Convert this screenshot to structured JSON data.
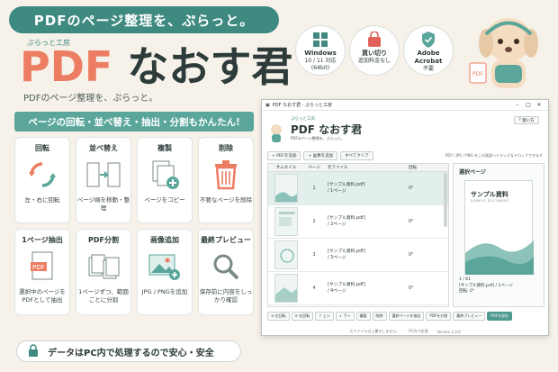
{
  "banner": {
    "text": "PDFのページ整理を、ぷらっと。"
  },
  "brand": {
    "subtitle": "ぷらっと工房",
    "title_pdf": "PDF",
    "title_rest": "なおす君",
    "tagline": "PDFのページ整理を、ぷらっと。"
  },
  "badges": [
    {
      "icon": "windows-icon",
      "line1": "Windows",
      "line2": "10 / 11 対応",
      "line3": "(64bit)"
    },
    {
      "icon": "shopping-bag-icon",
      "line1": "買い切り",
      "line2": "追加料金なし",
      "line3": ""
    },
    {
      "icon": "shield-check-icon",
      "line1": "Adobe Acrobat",
      "line2": "不要",
      "line3": ""
    }
  ],
  "feature_heading": "ページの回転・並べ替え・抽出・分割もかんたん!",
  "features": [
    {
      "name": "回転",
      "icon": "rotate-icon",
      "desc": "左・右に回転"
    },
    {
      "name": "並べ替え",
      "icon": "reorder-icon",
      "desc": "ページ順を移動・整理"
    },
    {
      "name": "複製",
      "icon": "duplicate-icon",
      "desc": "ページをコピー"
    },
    {
      "name": "削除",
      "icon": "trash-icon",
      "desc": "不要なページを削除"
    },
    {
      "name": "1ページ抽出",
      "icon": "pdf-extract-icon",
      "desc": "選択中のページをPDFとして抽出"
    },
    {
      "name": "PDF分割",
      "icon": "split-icon",
      "desc": "1ページずつ、範囲ごとに分割"
    },
    {
      "name": "画像追加",
      "icon": "image-add-icon",
      "desc": "JPG / PNGを追加"
    },
    {
      "name": "最終プレビュー",
      "icon": "magnifier-icon",
      "desc": "保存前に内容をしっかり確認"
    }
  ],
  "footer_note": "データはPC内で処理するので安心・安全",
  "colors": {
    "accent": "#3f8a80",
    "brand_pdf": "#ec7d63",
    "background": "#f6f2ea"
  },
  "window": {
    "title": "PDF なおす君 - ぷらっと工房",
    "app_sub": "ぷらっと工房",
    "app_title": "PDF なおす君",
    "app_tag": "PDFのページ整理を、ぷらっと。",
    "help_button": "使い方",
    "toolbar": {
      "add_pdf": "+ PDFを追加",
      "add_image": "+ 画像を追加",
      "clear": "すべてクリア",
      "hint": "PDF / JPG / PNG をこの画面へドラッグ＆ドロップできます"
    },
    "table": {
      "headers": [
        "サムネイル",
        "ページ",
        "元ファイル",
        "回転"
      ],
      "rows": [
        {
          "page": "1",
          "source": "[サンプル資料.pdf]",
          "source2": "/ 1ページ",
          "rotation": "0°"
        },
        {
          "page": "2",
          "source": "[サンプル資料.pdf]",
          "source2": "/ 2ページ",
          "rotation": "0°"
        },
        {
          "page": "3",
          "source": "[サンプル資料.pdf]",
          "source2": "/ 3ページ",
          "rotation": "0°"
        },
        {
          "page": "4",
          "source": "[サンプル資料.pdf]",
          "source2": "/ 4ページ",
          "rotation": "0°"
        }
      ]
    },
    "preview": {
      "label": "選択ページ",
      "doc_title": "サンプル資料",
      "doc_sub": "SAMPLE DOCUMENT",
      "info1": "1 / 61",
      "info2": "[サンプル資料.pdf] / 1ページ",
      "info3": "回転: 0°"
    },
    "bottom_buttons": [
      "⟲ 左回転",
      "⟳ 右回転",
      "↑ 上へ",
      "↓ 下へ",
      "複製",
      "削除",
      "選択ページを抽出",
      "PDFを分割",
      "最終プレビュー",
      "PDFを保存"
    ],
    "status": {
      "left": "元ファイルは上書きしません。",
      "mid": "PC内で処理",
      "right": "Version 1.0.0"
    }
  }
}
